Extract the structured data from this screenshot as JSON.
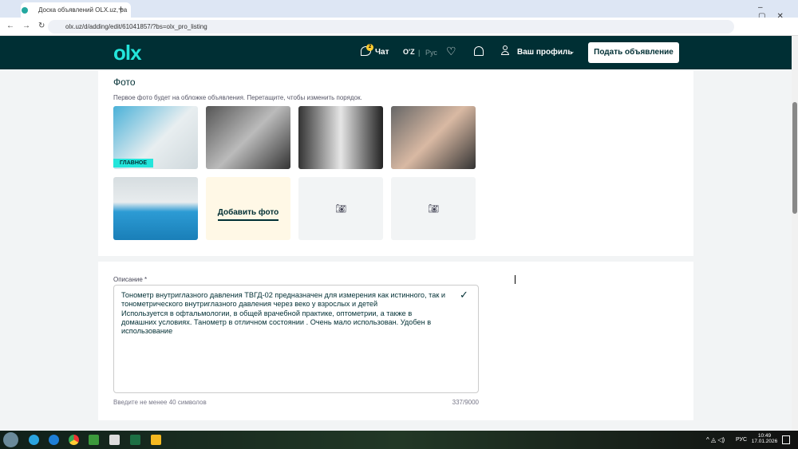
{
  "browser": {
    "tab_title": "Доска объявлений OLX.uz, ра",
    "url": "olx.uz/d/adding/edit/61041857/?bs=olx_pro_listing"
  },
  "header": {
    "logo": "olx",
    "chat_label": "Чат",
    "chat_badge": "2",
    "lang_uz": "O'Z",
    "lang_ru": "Рус",
    "profile_label": "Ваш профиль",
    "post_button": "Подать объявление"
  },
  "photos": {
    "title": "Фото",
    "hint": "Первое фото будет на обложке объявления. Перетащите, чтобы изменить порядок.",
    "main_badge": "ГЛАВНОЕ",
    "add_photo": "Добавить фото"
  },
  "description": {
    "label": "Описание *",
    "text": "Тонометр внутриглазного давления ТВГД-02 предназначен для измерения как истинного, так и тонометрического внутриглазного давления через веко у взрослых и детей\nИспользуется в офтальмологии, в общей врачебной практике, оптометрии, а также в домашних условиях. Танометр в отличном состоянии . Очень мало использован. Удобен в использование",
    "hint": "Введите не менее 40 символов",
    "counter": "337/9000"
  },
  "taskbar": {
    "lang": "РУС",
    "time": "10:49",
    "date": "17.01.2026"
  },
  "colors": {
    "brand": "#002f34",
    "accent": "#23e5db"
  }
}
